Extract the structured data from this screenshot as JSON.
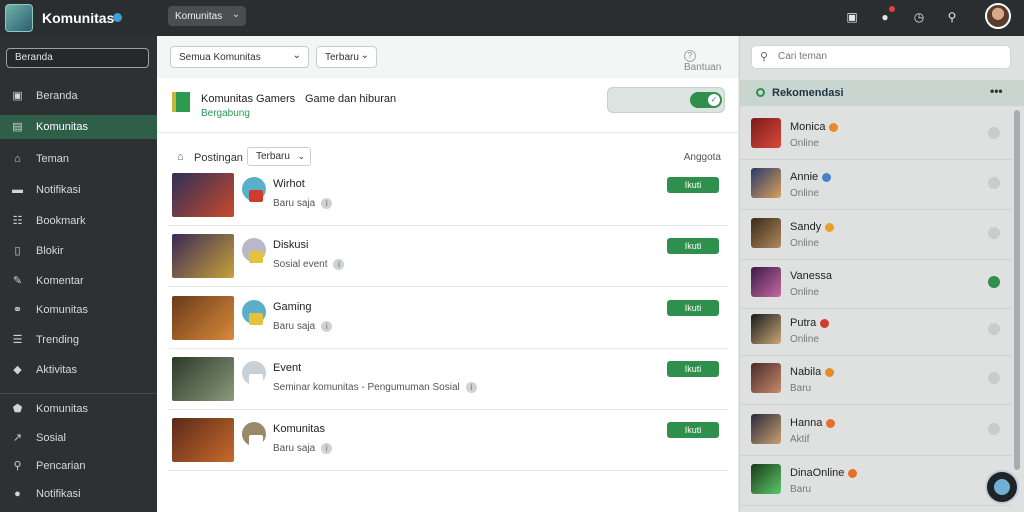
{
  "header": {
    "app_title": "Komunitas",
    "dropdown_label": "Komunitas",
    "dropdown_chevron": "⌄",
    "icons": [
      "inbox-icon",
      "notification-icon",
      "clock-icon",
      "tree-icon"
    ],
    "icon_glyphs": [
      "▣",
      "●",
      "◷",
      "⚲"
    ]
  },
  "sidebar": {
    "search_value": "Beranda",
    "items": [
      {
        "label": "Beranda",
        "icon": "home-icon",
        "glyph": "▣"
      },
      {
        "label": "Komunitas",
        "icon": "community-icon",
        "glyph": "▤"
      },
      {
        "label": "Teman",
        "icon": "house-icon",
        "glyph": "⌂"
      },
      {
        "label": "Notifikasi",
        "icon": "message-icon",
        "glyph": "▬"
      },
      {
        "label": "Bookmark",
        "icon": "bookmark-icon",
        "glyph": "☷"
      },
      {
        "label": "Blokir",
        "icon": "block-icon",
        "glyph": "▯"
      },
      {
        "label": "Komentar",
        "icon": "comment-icon",
        "glyph": "✎"
      },
      {
        "label": "Komunitas",
        "icon": "link-icon",
        "glyph": "⚭"
      },
      {
        "label": "Trending",
        "icon": "list-icon",
        "glyph": "☰"
      },
      {
        "label": "Aktivitas",
        "icon": "tag-icon",
        "glyph": "◆"
      },
      {
        "label": "Komunitas",
        "icon": "shield-icon",
        "glyph": "⬟"
      },
      {
        "label": "Sosial",
        "icon": "chart-icon",
        "glyph": "↗"
      },
      {
        "label": "Pencarian",
        "icon": "search-icon",
        "glyph": "⚲"
      },
      {
        "label": "Notifikasi",
        "icon": "info-icon",
        "glyph": "●"
      }
    ]
  },
  "center": {
    "filter_primary": "Semua Komunitas",
    "filter_secondary": "Terbaru",
    "help_label": "Bantuan",
    "community": {
      "name": "Komunitas Gamers",
      "description": "Game dan hiburan",
      "status": "Bergabung"
    },
    "toggle_check": "✓",
    "sort": {
      "label": "Postingan",
      "value": "Terbaru",
      "members_label": "Anggota"
    },
    "follow_label": "Ikuti",
    "info_glyph": "i",
    "posts": [
      {
        "title": "Wirhot",
        "meta": "Baru saja",
        "thumb": [
          "#2f2f5a",
          "#c84a2a"
        ],
        "avatar": "#5ab0c8",
        "badge": "#d23a2a"
      },
      {
        "title": "Diskusi",
        "meta": "Sosial event",
        "thumb": [
          "#3a2a55",
          "#c8a03a"
        ],
        "avatar": "#b8b8c8",
        "badge": "#e6c23a"
      },
      {
        "title": "Gaming",
        "meta": "Baru saja",
        "thumb": [
          "#6a3a1a",
          "#d88a3a"
        ],
        "avatar": "#5ab0c8",
        "badge": "#e6c23a"
      },
      {
        "title": "Event",
        "meta": "Seminar komunitas - Pengumuman Sosial",
        "thumb": [
          "#2a3a2a",
          "#8a9a7a"
        ],
        "avatar": "#c8d0d8",
        "badge": "#ffffff"
      },
      {
        "title": "Komunitas",
        "meta": "Baru saja",
        "thumb": [
          "#5a2a1a",
          "#c86a2a"
        ],
        "avatar": "#9a8a6a",
        "badge": "#ffffff"
      }
    ]
  },
  "right": {
    "search_placeholder": "Cari teman",
    "header_label": "Rekomendasi",
    "more_glyph": "•••",
    "friends": [
      {
        "name": "Monica",
        "sub": "Online",
        "avatar": [
          "#7a1a1a",
          "#d84a3a"
        ],
        "badge": "#e68a2a",
        "online": false
      },
      {
        "name": "Annie",
        "sub": "Online",
        "avatar": [
          "#2a3a6a",
          "#d8a05a"
        ],
        "badge": "#4a80c8",
        "online": false
      },
      {
        "name": "Sandy",
        "sub": "Online",
        "avatar": [
          "#3a2a1a",
          "#b08a5a"
        ],
        "badge": "#e6a02a",
        "online": false
      },
      {
        "name": "Vanessa",
        "sub": "Online",
        "avatar": [
          "#3a1a4a",
          "#c86aa0"
        ],
        "badge": "",
        "online": true
      },
      {
        "name": "Putra",
        "sub": "Online",
        "avatar": [
          "#1a1a1a",
          "#c8a87a"
        ],
        "badge": "#d23a2a",
        "online": false
      },
      {
        "name": "Nabila",
        "sub": "Baru",
        "avatar": [
          "#4a2a2a",
          "#c88a6a"
        ],
        "badge": "#e68a2a",
        "online": false
      },
      {
        "name": "Hanna",
        "sub": "Aktif",
        "avatar": [
          "#2a2a3a",
          "#c8a070"
        ],
        "badge": "#e6702a",
        "online": false
      },
      {
        "name": "DinaOnline",
        "sub": "Baru",
        "avatar": [
          "#1a3a1a",
          "#5ac86a"
        ],
        "badge": "#e6702a",
        "online": false
      }
    ]
  }
}
